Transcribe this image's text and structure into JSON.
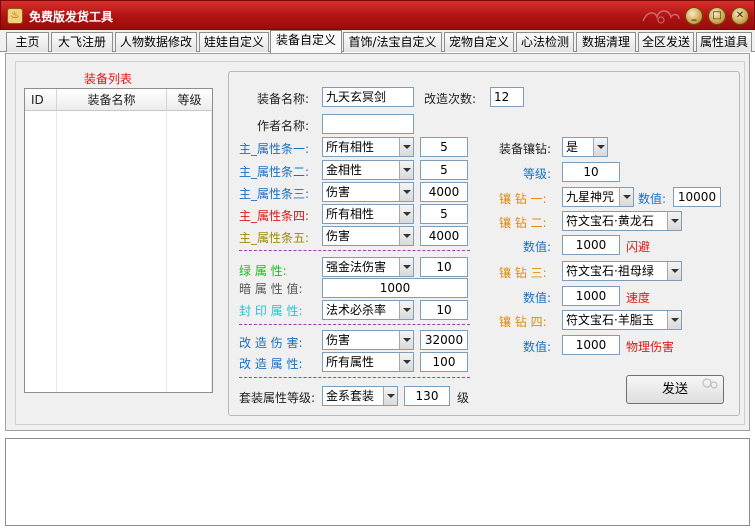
{
  "window": {
    "title": "免费版发货工具",
    "icon": "app-icon",
    "controls": {
      "minimize": "_",
      "maximize": "□",
      "close": "✕"
    }
  },
  "tabs": [
    {
      "label": "主页"
    },
    {
      "label": "大飞注册"
    },
    {
      "label": "人物数据修改"
    },
    {
      "label": "娃娃自定义"
    },
    {
      "label": "装备自定义"
    },
    {
      "label": "首饰/法宝自定义"
    },
    {
      "label": "宠物自定义"
    },
    {
      "label": "心法检测"
    },
    {
      "label": "数据清理"
    },
    {
      "label": "全区发送"
    },
    {
      "label": "属性道具"
    }
  ],
  "active_tab": "装备自定义",
  "equip_list": {
    "title": "装备列表",
    "columns": [
      "ID",
      "装备名称",
      "等级"
    ]
  },
  "form": {
    "name_label": "装备名称:",
    "name_value": "九天玄冥剑",
    "modify_count_label": "改造次数:",
    "modify_count_value": "12",
    "author_label": "作者名称:",
    "author_value": "",
    "main_attrs": [
      {
        "label": "主_属性条一:",
        "select": "所有相性",
        "value": "5",
        "color": "#1a6fc0"
      },
      {
        "label": "主_属性条二:",
        "select": "金相性",
        "value": "5",
        "color": "#1a6fc0"
      },
      {
        "label": "主_属性条三:",
        "select": "伤害",
        "value": "4000",
        "color": "#1a6fc0"
      },
      {
        "label": "主_属性条四:",
        "select": "所有相性",
        "value": "5",
        "color": "#d81818"
      },
      {
        "label": "主_属性条五:",
        "select": "伤害",
        "value": "4000",
        "color": "#a08a00"
      }
    ],
    "green_attr": {
      "label": "绿  属  性:",
      "select": "强金法伤害",
      "value": "10",
      "color": "#16c016"
    },
    "dark_attr": {
      "label": "暗 属 性 值:",
      "value": "1000",
      "color": "#555555"
    },
    "seal_attr": {
      "label": "封 印 属 性:",
      "select": "法术必杀率",
      "value": "10",
      "color": "#18c8d8"
    },
    "modify_damage": {
      "label": "改 造 伤 害:",
      "select": "伤害",
      "value": "32000",
      "color": "#1a6fc0"
    },
    "modify_attr": {
      "label": "改 造 属 性:",
      "select": "所有属性",
      "value": "100",
      "color": "#1a6fc0"
    },
    "suit": {
      "label": "套装属性等级:",
      "select": "金系套装",
      "value": "130",
      "unit": "级"
    },
    "inlay_label": "装备镶钻:",
    "inlay_value": "是",
    "level_label": "等级:",
    "level_value": "10",
    "gems": [
      {
        "label": "镶 钻 一:",
        "select": "九星神咒",
        "value_label": "数值:",
        "value": "10000",
        "effect": ""
      },
      {
        "label": "镶 钻 二:",
        "select": "符文宝石·黄龙石",
        "value_label": "数值:",
        "value": "1000",
        "effect": "闪避"
      },
      {
        "label": "镶 钻 三:",
        "select": "符文宝石·祖母绿",
        "value_label": "数值:",
        "value": "1000",
        "effect": "速度"
      },
      {
        "label": "镶 钻 四:",
        "select": "符文宝石·羊脂玉",
        "value_label": "数值:",
        "value": "1000",
        "effect": "物理伤害"
      }
    ],
    "gem_label_color": "#e08a10",
    "effect_color": "#e01818",
    "send_button": "发送"
  },
  "log_text": ""
}
